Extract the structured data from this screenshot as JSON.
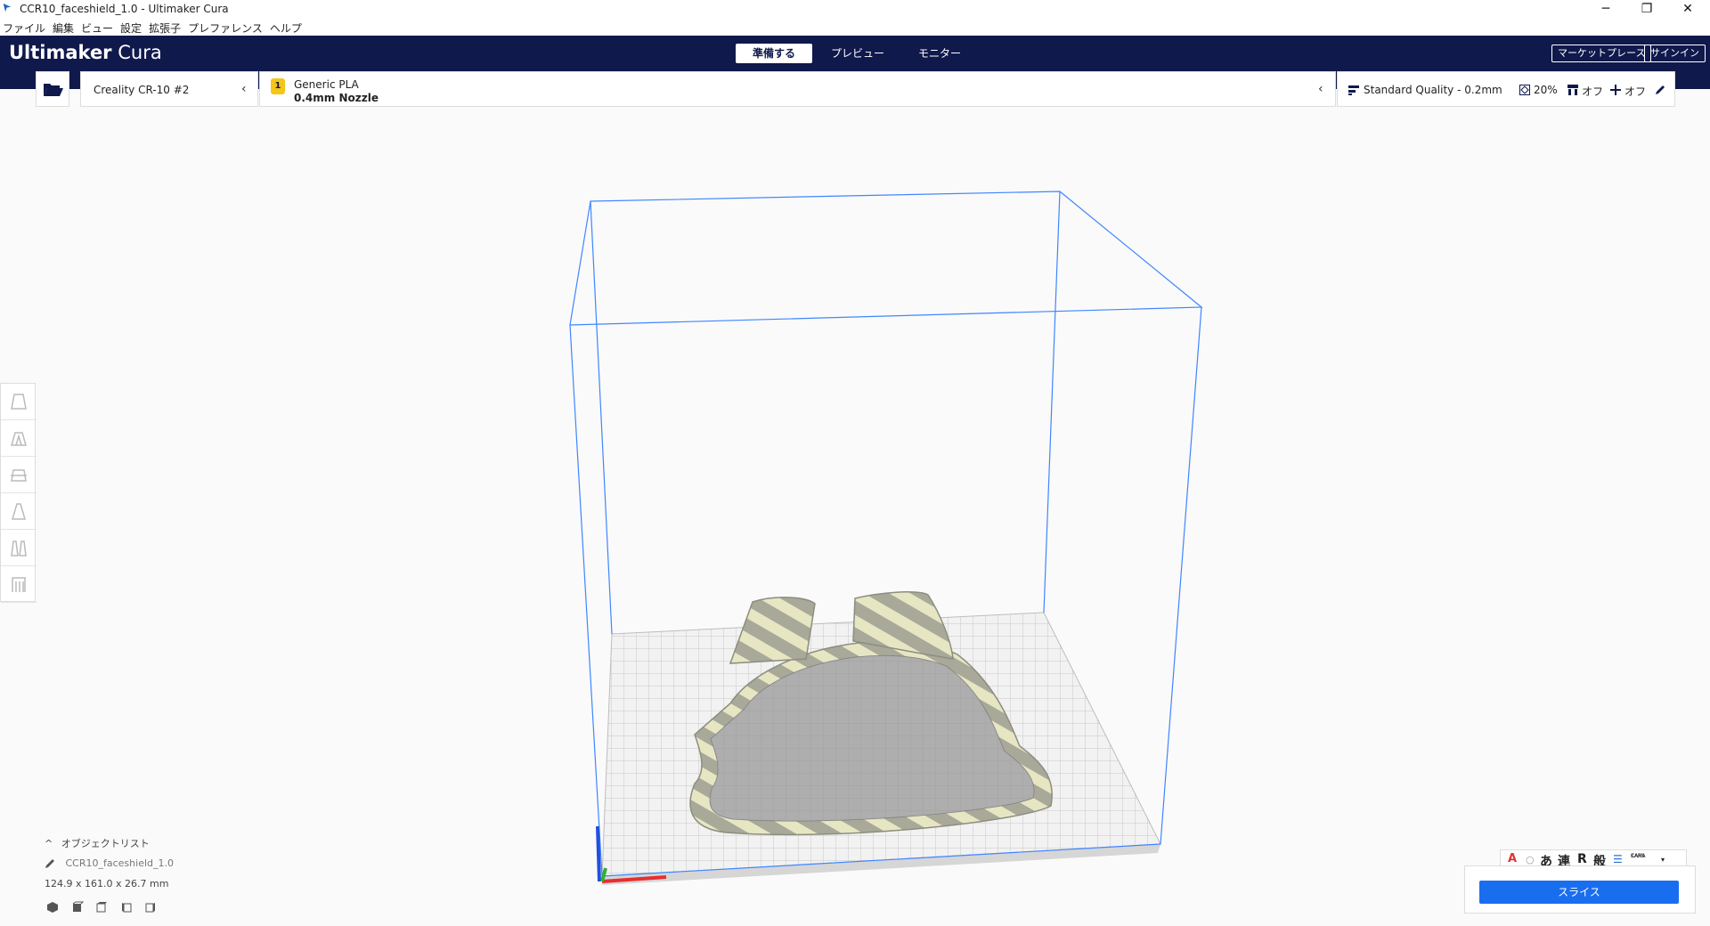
{
  "window": {
    "title": "CCR10_faceshield_1.0 - Ultimaker Cura"
  },
  "menu": [
    "ファイル",
    "編集",
    "ビュー",
    "設定",
    "拡張子",
    "プレファレンス",
    "ヘルプ"
  ],
  "header": {
    "brand_bold": "Ultimaker",
    "brand_light": "Cura",
    "stages": [
      "準備する",
      "プレビュー",
      "モニター"
    ],
    "marketplace": "マーケットプレース",
    "signin": "サインイン"
  },
  "printer": {
    "name": "Creality CR-10 #2"
  },
  "material": {
    "name": "Generic PLA",
    "nozzle": "0.4mm Nozzle",
    "badge": "1"
  },
  "quality": {
    "profile": "Standard Quality - 0.2mm",
    "infill": "20%",
    "support": "オフ",
    "adhesion": "オフ"
  },
  "object_list": {
    "label": "オブジェクトリスト",
    "file": "CCR10_faceshield_1.0",
    "dimensions": "124.9 x 161.0 x 26.7 mm"
  },
  "ime": {
    "hira": "あ",
    "ren": "連",
    "r": "R",
    "han": "般",
    "caps": "CAPS",
    "kana": "KANA"
  },
  "slice": {
    "label": "スライス"
  },
  "colors": {
    "header": "#10194c",
    "accent": "#196ef0",
    "build_volume": "#3f86ff"
  },
  "icons": [
    "folder-open-icon",
    "chevron-left-icon",
    "quality-icon",
    "infill-icon",
    "support-icon",
    "adhesion-icon",
    "pencil-icon",
    "move-tool-icon",
    "scale-tool-icon",
    "rotate-tool-icon",
    "mirror-tool-icon",
    "per-model-settings-icon",
    "support-blocker-icon"
  ]
}
